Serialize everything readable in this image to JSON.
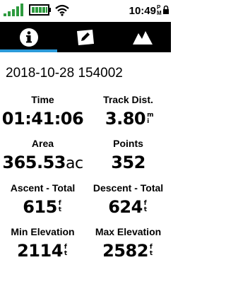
{
  "status": {
    "time": "10:49",
    "ampm": "PM",
    "signal_bars": 5,
    "battery_level": 1.0,
    "icons": [
      "signal-icon",
      "battery-icon",
      "wifi-icon",
      "lock-icon"
    ]
  },
  "tabs": [
    {
      "name": "info",
      "icon": "info-icon",
      "active": true
    },
    {
      "name": "edit",
      "icon": "edit-map-icon",
      "active": false
    },
    {
      "name": "profile",
      "icon": "elevation-profile-icon",
      "active": false
    }
  ],
  "track": {
    "name": "2018-10-28 154002",
    "fields": [
      {
        "label": "Time",
        "value": "01:41:06",
        "unit": ""
      },
      {
        "label": "Track Dist.",
        "value": "3.80",
        "unit": "mi"
      },
      {
        "label": "Area",
        "value": "365.53",
        "unit": "ac"
      },
      {
        "label": "Points",
        "value": "352",
        "unit": ""
      },
      {
        "label": "Ascent - Total",
        "value": "615",
        "unit": "ft"
      },
      {
        "label": "Descent - Total",
        "value": "624",
        "unit": "ft"
      },
      {
        "label": "Min Elevation",
        "value": "2114",
        "unit": "ft"
      },
      {
        "label": "Max Elevation",
        "value": "2582",
        "unit": "ft"
      }
    ]
  },
  "colors": {
    "accent": "#2b9ad9",
    "battery": "#2e9b3f",
    "tab_bg": "#000000"
  }
}
